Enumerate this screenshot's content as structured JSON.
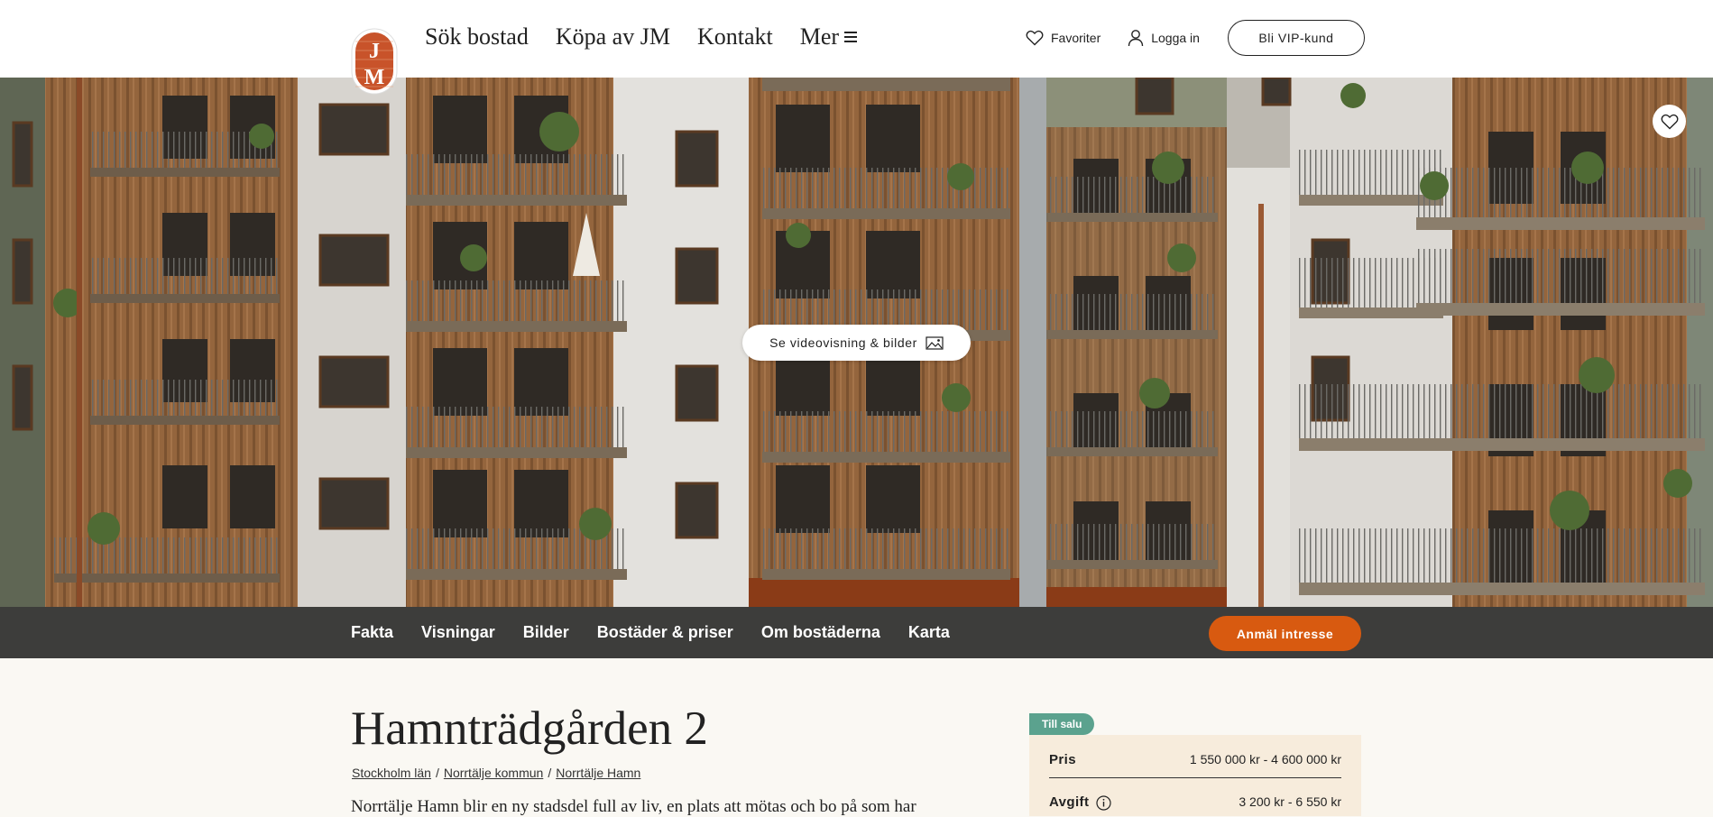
{
  "header": {
    "nav": [
      {
        "label": "Sök bostad"
      },
      {
        "label": "Köpa av JM"
      },
      {
        "label": "Kontakt"
      },
      {
        "label": "Mer"
      }
    ],
    "favorites_label": "Favoriter",
    "login_label": "Logga in",
    "vip_label": "Bli VIP-kund",
    "icons": {
      "favorites": "heart-icon",
      "login": "user-icon",
      "more": "hamburger-icon"
    }
  },
  "logo": {
    "alt": "JM logo"
  },
  "hero": {
    "video_button_label": "Se videovisning & bilder",
    "video_icon": "image-icon",
    "favorite_icon": "heart-icon"
  },
  "subnav": {
    "links": [
      {
        "label": "Fakta"
      },
      {
        "label": "Visningar"
      },
      {
        "label": "Bilder"
      },
      {
        "label": "Bostäder & priser"
      },
      {
        "label": "Om bostäderna"
      },
      {
        "label": "Karta"
      }
    ],
    "cta_label": "Anmäl intresse"
  },
  "project": {
    "title": "Hamnträdgården 2",
    "breadcrumb": [
      "Stockholm län",
      "Norrtälje kommun",
      "Norrtälje Hamn"
    ],
    "intro": "Norrtälje Hamn blir en ny stadsdel full av liv, en plats att mötas och bo på som har"
  },
  "status": {
    "badge": "Till salu",
    "price_label": "Pris",
    "price_value": "1 550 000 kr - 4 600 000 kr",
    "fee_label": "Avgift",
    "fee_value": "3 200 kr - 6 550 kr"
  },
  "colors": {
    "header_bg": "#ffffff",
    "subnav_bg": "#3d3d3b",
    "cta": "#d85a10",
    "badge": "#5ba28e",
    "price_box": "#f7ecdc",
    "page_bg": "#faf8f3"
  }
}
